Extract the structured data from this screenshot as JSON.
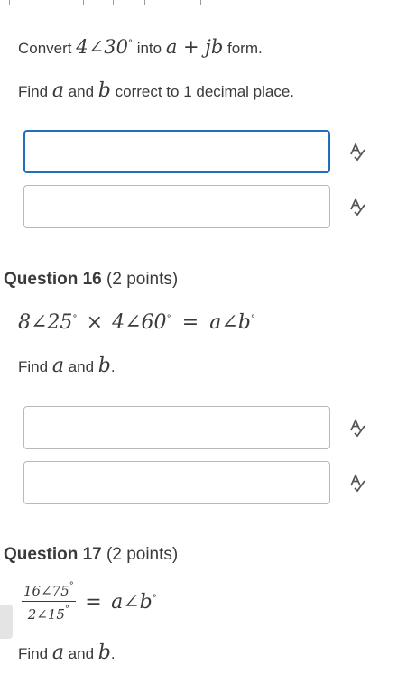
{
  "q15": {
    "prefix": "Convert",
    "expr": "4∠30",
    "mid": "into",
    "form_expr": "a + jb",
    "suffix": "form.",
    "find_pre": "Find",
    "var_a": "a",
    "find_and": "and",
    "var_b": "b",
    "find_post": "correct to 1 decimal place.",
    "inputs": [
      {
        "value": "",
        "placeholder": ""
      },
      {
        "value": "",
        "placeholder": ""
      }
    ]
  },
  "q16": {
    "title_num": "Question 16",
    "title_points": "(2 points)",
    "expr_left": "8∠25",
    "times": "×",
    "expr_mid": "4∠60",
    "equals": "=",
    "expr_right": "a∠b",
    "find_pre": "Find",
    "var_a": "a",
    "find_and": "and",
    "var_b": "b",
    "find_post": ".",
    "inputs": [
      {
        "value": "",
        "placeholder": ""
      },
      {
        "value": "",
        "placeholder": ""
      }
    ]
  },
  "q17": {
    "title_num": "Question 17",
    "title_points": "(2 points)",
    "frac_num": "16∠75",
    "frac_den": "2∠15",
    "equals": "=",
    "expr_right": "a∠b",
    "find_pre": "Find",
    "var_a": "a",
    "find_and": "and",
    "var_b": "b",
    "find_post": "."
  },
  "degree_symbol": "°",
  "spell_icon": "spell-check-icon",
  "focus_color": "#1f6fbd"
}
